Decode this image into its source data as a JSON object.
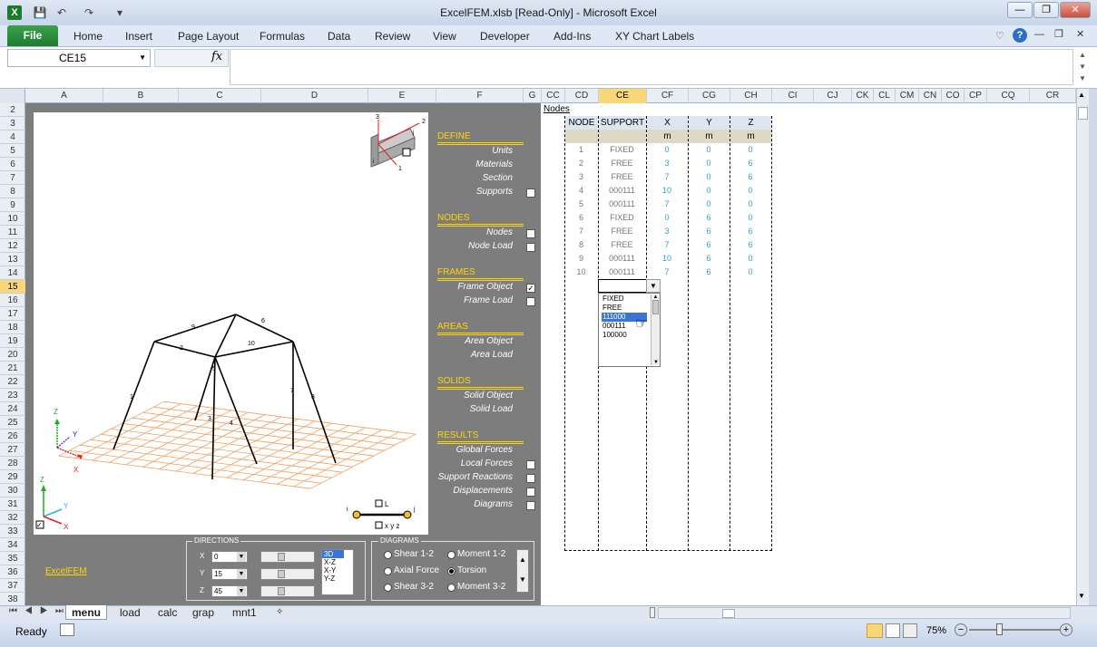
{
  "window": {
    "title": "ExcelFEM.xlsb  [Read-Only]  -  Microsoft Excel"
  },
  "ribbon": {
    "file_tab": "File",
    "tabs": [
      "Home",
      "Insert",
      "Page Layout",
      "Formulas",
      "Data",
      "Review",
      "View",
      "Developer",
      "Add-Ins",
      "XY Chart Labels"
    ]
  },
  "formula_bar": {
    "name_box": "CE15",
    "fx": "fx",
    "formula": ""
  },
  "columns": [
    "A",
    "B",
    "C",
    "D",
    "E",
    "F",
    "G",
    "CC",
    "CD",
    "CE",
    "CF",
    "CG",
    "CH",
    "CI",
    "CJ",
    "CK",
    "CL",
    "CM",
    "CN",
    "CO",
    "CP",
    "CQ",
    "CR"
  ],
  "selected_column": "CE",
  "rows": [
    "2",
    "3",
    "4",
    "5",
    "6",
    "7",
    "8",
    "9",
    "10",
    "11",
    "12",
    "13",
    "14",
    "15",
    "16",
    "17",
    "18",
    "19",
    "20",
    "21",
    "22",
    "23",
    "24",
    "25",
    "26",
    "27",
    "28",
    "29",
    "30",
    "31",
    "32",
    "33",
    "34",
    "35",
    "36",
    "37",
    "38"
  ],
  "selected_row": "15",
  "viewport": {
    "axis_labels": {
      "x": "X",
      "y": "Y",
      "z": "Z"
    },
    "beam_axes": {
      "a1": "1",
      "a2": "2",
      "a3": "3",
      "i": "i",
      "j": "j"
    },
    "member_labels": [
      "1",
      "2",
      "3",
      "4",
      "5",
      "6",
      "7",
      "8",
      "9",
      "10"
    ],
    "element_legend": {
      "i": "i",
      "j": "j",
      "L": "L",
      "xyz": "x y z"
    }
  },
  "menu": {
    "sections": [
      {
        "title": "DEFINE",
        "items": [
          {
            "label": "Units",
            "checkbox": false
          },
          {
            "label": "Materials",
            "checkbox": false
          },
          {
            "label": "Section",
            "checkbox": false
          },
          {
            "label": "Supports",
            "checkbox": true,
            "checked": false
          }
        ]
      },
      {
        "title": "NODES",
        "items": [
          {
            "label": "Nodes",
            "checkbox": true,
            "checked": false
          },
          {
            "label": "Node Load",
            "checkbox": true,
            "checked": false
          }
        ]
      },
      {
        "title": "FRAMES",
        "items": [
          {
            "label": "Frame Object",
            "checkbox": true,
            "checked": true
          },
          {
            "label": "Frame Load",
            "checkbox": true,
            "checked": false
          }
        ]
      },
      {
        "title": "AREAS",
        "items": [
          {
            "label": "Area Object",
            "checkbox": false
          },
          {
            "label": "Area Load",
            "checkbox": false
          }
        ]
      },
      {
        "title": "SOLIDS",
        "items": [
          {
            "label": "Solid Object",
            "checkbox": false
          },
          {
            "label": "Solid Load",
            "checkbox": false
          }
        ]
      },
      {
        "title": "RESULTS",
        "items": [
          {
            "label": "Global Forces",
            "checkbox": false
          },
          {
            "label": "Local Forces",
            "checkbox": true,
            "checked": false
          },
          {
            "label": "Support Reactions",
            "checkbox": true,
            "checked": false
          },
          {
            "label": "Displacements",
            "checkbox": true,
            "checked": false
          },
          {
            "label": "Diagrams",
            "checkbox": true,
            "checked": false
          }
        ]
      }
    ]
  },
  "excelfem_link": "ExcelFEM",
  "directions": {
    "title": "DIRECTIONS",
    "rows": [
      {
        "axis": "X",
        "value": "0"
      },
      {
        "axis": "Y",
        "value": "15"
      },
      {
        "axis": "Z",
        "value": "45"
      }
    ],
    "views": [
      "3D",
      "X-Z",
      "X-Y",
      "Y-Z"
    ],
    "selected_view": "3D"
  },
  "diagrams": {
    "title": "DIAGRAMS",
    "options": [
      {
        "label": "Shear 1-2",
        "selected": false
      },
      {
        "label": "Moment 1-2",
        "selected": false
      },
      {
        "label": "Axial Force",
        "selected": false
      },
      {
        "label": "Torsion",
        "selected": true
      },
      {
        "label": "Shear 3-2",
        "selected": false
      },
      {
        "label": "Moment 3-2",
        "selected": false
      }
    ]
  },
  "nodes_table": {
    "title": "Nodes",
    "headers": [
      "NODE",
      "SUPPORT",
      "X",
      "Y",
      "Z"
    ],
    "units": [
      "",
      "",
      "m",
      "m",
      "m"
    ],
    "rows": [
      [
        "1",
        "FIXED",
        "0",
        "0",
        "0"
      ],
      [
        "2",
        "FREE",
        "3",
        "0",
        "6"
      ],
      [
        "3",
        "FREE",
        "7",
        "0",
        "6"
      ],
      [
        "4",
        "000111",
        "10",
        "0",
        "0"
      ],
      [
        "5",
        "000111",
        "7",
        "0",
        "0"
      ],
      [
        "6",
        "FIXED",
        "0",
        "6",
        "0"
      ],
      [
        "7",
        "FREE",
        "3",
        "6",
        "6"
      ],
      [
        "8",
        "FREE",
        "7",
        "6",
        "6"
      ],
      [
        "9",
        "000111",
        "10",
        "6",
        "0"
      ],
      [
        "10",
        "000111",
        "7",
        "6",
        "0"
      ]
    ]
  },
  "support_dropdown": {
    "options": [
      "FIXED",
      "FREE",
      "111000",
      "000111",
      "100000"
    ],
    "highlighted": "111000"
  },
  "sheet_tabs": [
    "menu",
    "load",
    "calc",
    "grap",
    "mnt1"
  ],
  "active_sheet": "menu",
  "status": {
    "text": "Ready",
    "zoom": "75%"
  },
  "colors": {
    "accent": "#1e7b2e",
    "header_yellow": "#ffd700",
    "value_blue": "#2e9fd6",
    "grid_orange": "#f0a060"
  }
}
